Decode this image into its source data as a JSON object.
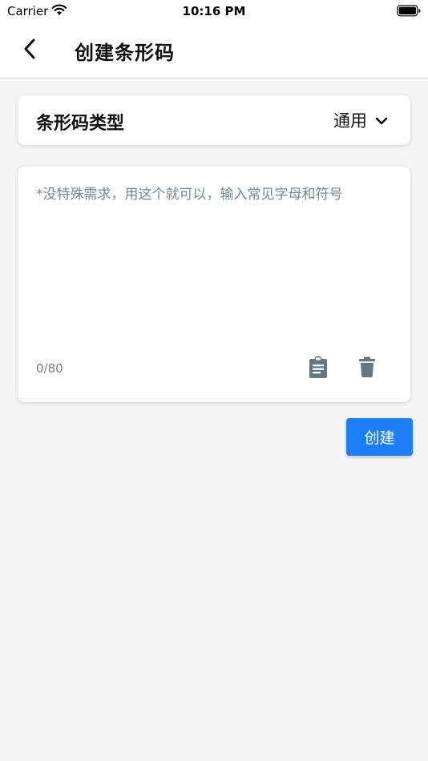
{
  "status_bar": {
    "carrier": "Carrier",
    "time": "10:16 PM",
    "wifi_icon": "wifi-icon",
    "battery_icon": "battery-full-icon"
  },
  "nav": {
    "back_icon": "chevron-left-icon",
    "title": "创建条形码"
  },
  "barcode_type": {
    "label": "条形码类型",
    "selected": "通用",
    "dropdown_icon": "chevron-down-icon"
  },
  "input": {
    "value": "",
    "placeholder": "*没特殊需求，用这个就可以，输入常见字母和符号",
    "counter": "0/80",
    "paste_icon": "clipboard-icon",
    "delete_icon": "trash-icon",
    "icon_color": "#5f7884"
  },
  "actions": {
    "create_label": "创建",
    "accent": "#1e7ef7"
  }
}
